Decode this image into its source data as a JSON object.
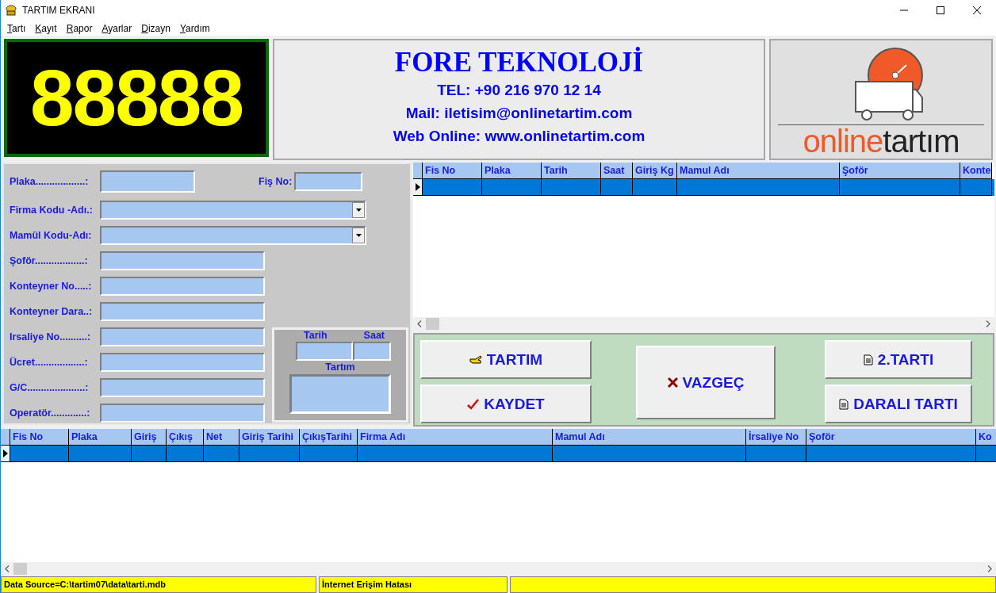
{
  "window": {
    "title": "TARTIM EKRANI"
  },
  "menu": [
    {
      "label": "Tartı"
    },
    {
      "label": "Kayıt"
    },
    {
      "label": "Rapor"
    },
    {
      "label": "Ayarlar"
    },
    {
      "label": "Dizayn"
    },
    {
      "label": "Yardım"
    }
  ],
  "display": {
    "reading": "88888"
  },
  "company": {
    "name": "FORE TEKNOLOJİ",
    "phone": "TEL: +90 216 970 12 14",
    "mail": "Mail: iletisim@onlinetartim.com",
    "web": "Web Online: www.onlinetartim.com"
  },
  "logo": {
    "word_first": "online",
    "word_second": "tartım"
  },
  "form": {
    "plaka": {
      "label": "Plaka..................:"
    },
    "fis_no": {
      "label": "Fiş No:"
    },
    "fields": [
      {
        "label": "Firma Kodu -Adı.:",
        "kind": "dropdown"
      },
      {
        "label": "Mamül Kodu-Adı:",
        "kind": "dropdown"
      },
      {
        "label": "Şoför..................:",
        "kind": "text"
      },
      {
        "label": "Konteyner No.....:",
        "kind": "text"
      },
      {
        "label": "Konteyner Dara..:",
        "kind": "text"
      },
      {
        "label": "Irsaliye No..........:",
        "kind": "text"
      },
      {
        "label": "Ücret..................:",
        "kind": "text"
      },
      {
        "label": "G/C.....................:",
        "kind": "text"
      },
      {
        "label": "Operatör.............:",
        "kind": "text"
      }
    ],
    "datebox": {
      "date_label": "Tarih",
      "time_label": "Saat",
      "weight_label": "Tartım"
    }
  },
  "top_grid": {
    "columns": [
      "Fis No",
      "Plaka",
      "Tarih",
      "Saat",
      "Giriş Kg",
      "Mamul Adı",
      "Şoför",
      "Konte"
    ],
    "rows": [
      {
        "selected": true
      }
    ]
  },
  "buttons": [
    {
      "label": "TARTIM",
      "kind": "weigh"
    },
    {
      "label": "KAYDET",
      "kind": "save"
    },
    {
      "label": "VAZGEÇ",
      "kind": "cancel"
    },
    {
      "label": "2.TARTI",
      "kind": "doc"
    },
    {
      "label": "DARALI TARTI",
      "kind": "doc"
    }
  ],
  "bottom_grid": {
    "columns": [
      "Fis No",
      "Plaka",
      "Giriş",
      "Çıkış",
      "Net",
      "Giriş Tarihi",
      "ÇıkışTarihi",
      "Firma Adı",
      "Mamul Adı",
      "İrsaliye No",
      "Şoför",
      "Ko"
    ],
    "rows": [
      {
        "selected": true
      }
    ]
  },
  "status_bar": [
    "Data Source=C:\\tartim07\\data\\tarti.mdb",
    "İnternet Erişim Hatası"
  ]
}
